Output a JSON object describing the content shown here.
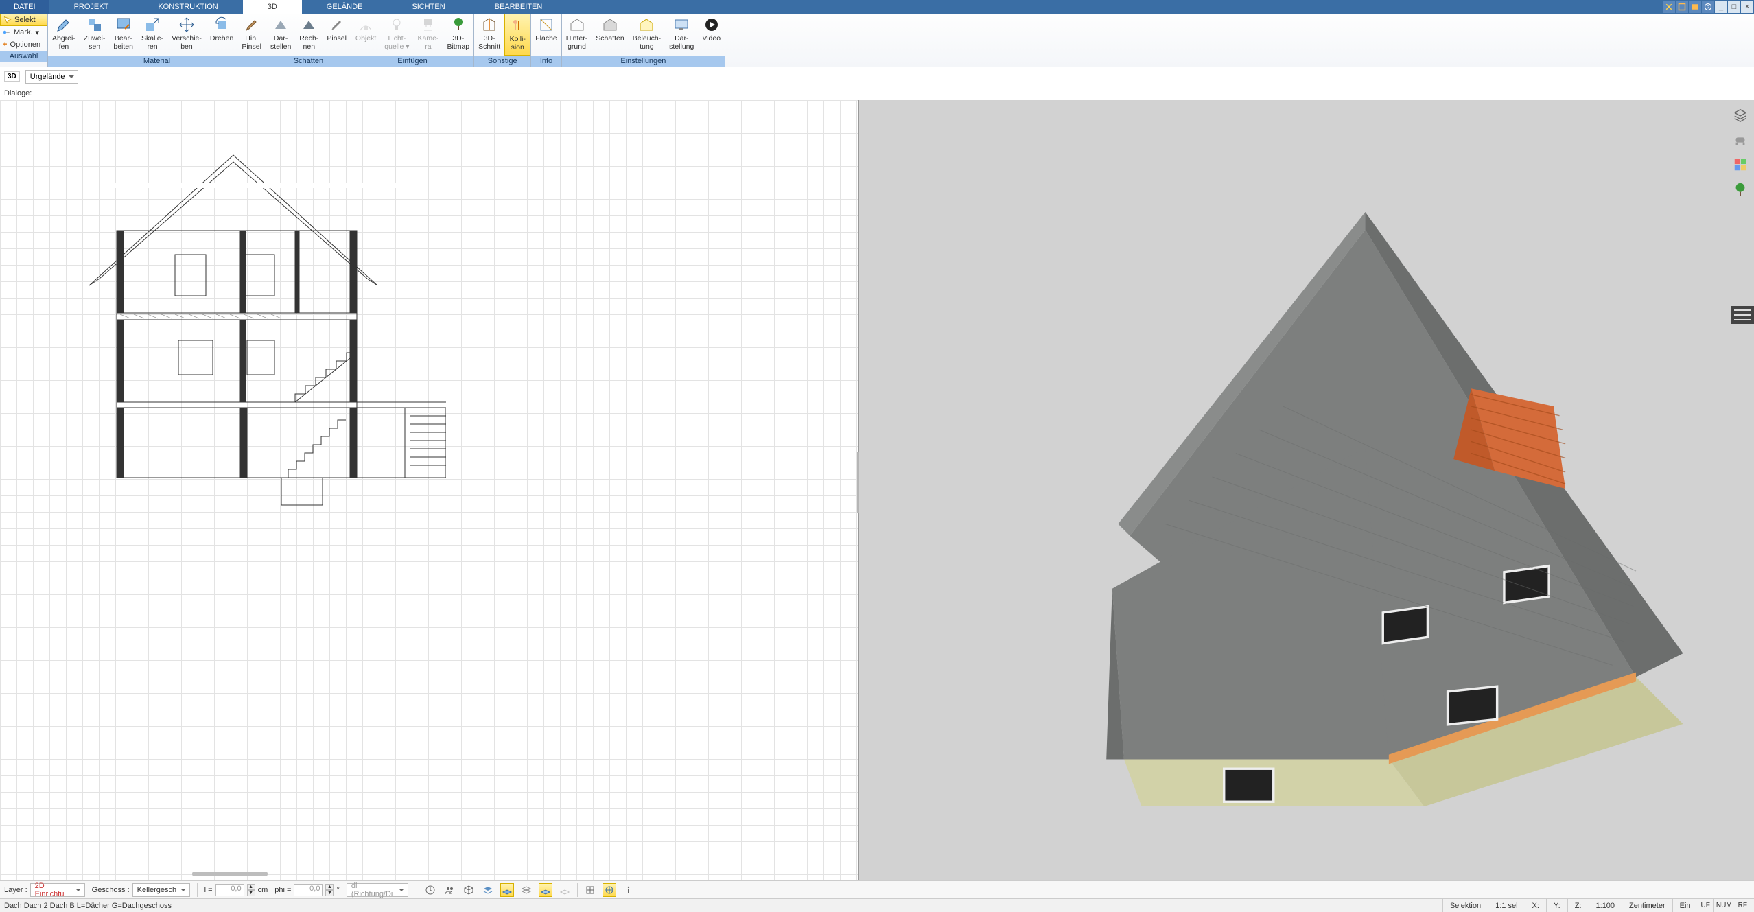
{
  "menu": {
    "datei": "DATEI",
    "projekt": "PROJEKT",
    "konstruktion": "KONSTRUKTION",
    "dreid": "3D",
    "gelaende": "GELÄNDE",
    "sichten": "SICHTEN",
    "bearbeiten": "BEARBEITEN"
  },
  "ribbon_left": {
    "selekt": "Selekt",
    "mark": "Mark.",
    "optionen": "Optionen",
    "group": "Auswahl"
  },
  "ribbon": {
    "material": {
      "title": "Material",
      "abgreifen": "Abgrei-\nfen",
      "zuweisen": "Zuwei-\nsen",
      "bearbeiten": "Bear-\nbeiten",
      "skalieren": "Skalie-\nren",
      "verschieben": "Verschie-\nben",
      "drehen": "Drehen",
      "pinsel": "Hin.\nPinsel"
    },
    "schatten": {
      "title": "Schatten",
      "darstellen": "Dar-\nstellen",
      "rechnen": "Rech-\nnen",
      "pinsel": "Pinsel"
    },
    "einfuegen": {
      "title": "Einfügen",
      "objekt": "Objekt",
      "lichtquelle": "Licht-\nquelle ▾",
      "kamera": "Kame-\nra",
      "bitmap": "3D-\nBitmap"
    },
    "sonstige": {
      "title": "Sonstige",
      "schnitt": "3D-\nSchnitt",
      "kollision": "Kolli-\nsion"
    },
    "info": {
      "title": "Info",
      "flaeche": "Fläche"
    },
    "einstellungen": {
      "title": "Einstellungen",
      "hintergrund": "Hinter-\ngrund",
      "schatten": "Schatten",
      "beleuchtung": "Beleuch-\ntung",
      "darstellung": "Dar-\nstellung",
      "video": "Video"
    }
  },
  "viewbar": {
    "mode": "3D",
    "layer_combo": "Urgelände"
  },
  "dialogbar": {
    "label": "Dialoge:"
  },
  "params": {
    "layer_label": "Layer :",
    "layer_value": "2D Einrichtu",
    "geschoss_label": "Geschoss :",
    "geschoss_value": "Kellergesch",
    "l_label": "l =",
    "l_value": "0,0",
    "l_unit": "cm",
    "phi_label": "phi =",
    "phi_value": "0,0",
    "phi_unit": "°",
    "dl_placeholder": "dl (Richtung/Di"
  },
  "status": {
    "left": "Dach Dach 2 Dach B L=Dächer G=Dachgeschoss",
    "selektion": "Selektion",
    "scale_sel": "1:1 sel",
    "x": "X:",
    "y": "Y:",
    "z": "Z:",
    "scale": "1:100",
    "unit": "Zentimeter",
    "ein": "Ein",
    "uf": "UF",
    "num": "NUM",
    "rf": "RF"
  }
}
